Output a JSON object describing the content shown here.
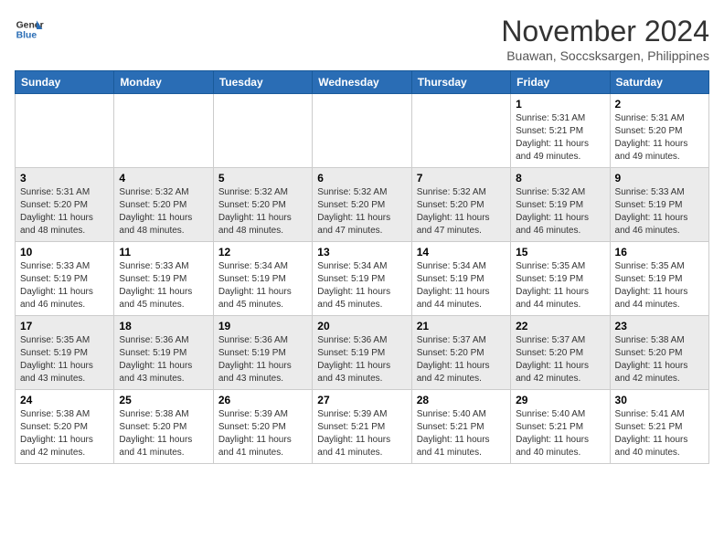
{
  "logo": {
    "line1": "General",
    "line2": "Blue"
  },
  "title": "November 2024",
  "subtitle": "Buawan, Soccsksargen, Philippines",
  "weekdays": [
    "Sunday",
    "Monday",
    "Tuesday",
    "Wednesday",
    "Thursday",
    "Friday",
    "Saturday"
  ],
  "weeks": [
    [
      {
        "day": "",
        "info": ""
      },
      {
        "day": "",
        "info": ""
      },
      {
        "day": "",
        "info": ""
      },
      {
        "day": "",
        "info": ""
      },
      {
        "day": "",
        "info": ""
      },
      {
        "day": "1",
        "info": "Sunrise: 5:31 AM\nSunset: 5:21 PM\nDaylight: 11 hours and 49 minutes."
      },
      {
        "day": "2",
        "info": "Sunrise: 5:31 AM\nSunset: 5:20 PM\nDaylight: 11 hours and 49 minutes."
      }
    ],
    [
      {
        "day": "3",
        "info": "Sunrise: 5:31 AM\nSunset: 5:20 PM\nDaylight: 11 hours and 48 minutes."
      },
      {
        "day": "4",
        "info": "Sunrise: 5:32 AM\nSunset: 5:20 PM\nDaylight: 11 hours and 48 minutes."
      },
      {
        "day": "5",
        "info": "Sunrise: 5:32 AM\nSunset: 5:20 PM\nDaylight: 11 hours and 48 minutes."
      },
      {
        "day": "6",
        "info": "Sunrise: 5:32 AM\nSunset: 5:20 PM\nDaylight: 11 hours and 47 minutes."
      },
      {
        "day": "7",
        "info": "Sunrise: 5:32 AM\nSunset: 5:20 PM\nDaylight: 11 hours and 47 minutes."
      },
      {
        "day": "8",
        "info": "Sunrise: 5:32 AM\nSunset: 5:19 PM\nDaylight: 11 hours and 46 minutes."
      },
      {
        "day": "9",
        "info": "Sunrise: 5:33 AM\nSunset: 5:19 PM\nDaylight: 11 hours and 46 minutes."
      }
    ],
    [
      {
        "day": "10",
        "info": "Sunrise: 5:33 AM\nSunset: 5:19 PM\nDaylight: 11 hours and 46 minutes."
      },
      {
        "day": "11",
        "info": "Sunrise: 5:33 AM\nSunset: 5:19 PM\nDaylight: 11 hours and 45 minutes."
      },
      {
        "day": "12",
        "info": "Sunrise: 5:34 AM\nSunset: 5:19 PM\nDaylight: 11 hours and 45 minutes."
      },
      {
        "day": "13",
        "info": "Sunrise: 5:34 AM\nSunset: 5:19 PM\nDaylight: 11 hours and 45 minutes."
      },
      {
        "day": "14",
        "info": "Sunrise: 5:34 AM\nSunset: 5:19 PM\nDaylight: 11 hours and 44 minutes."
      },
      {
        "day": "15",
        "info": "Sunrise: 5:35 AM\nSunset: 5:19 PM\nDaylight: 11 hours and 44 minutes."
      },
      {
        "day": "16",
        "info": "Sunrise: 5:35 AM\nSunset: 5:19 PM\nDaylight: 11 hours and 44 minutes."
      }
    ],
    [
      {
        "day": "17",
        "info": "Sunrise: 5:35 AM\nSunset: 5:19 PM\nDaylight: 11 hours and 43 minutes."
      },
      {
        "day": "18",
        "info": "Sunrise: 5:36 AM\nSunset: 5:19 PM\nDaylight: 11 hours and 43 minutes."
      },
      {
        "day": "19",
        "info": "Sunrise: 5:36 AM\nSunset: 5:19 PM\nDaylight: 11 hours and 43 minutes."
      },
      {
        "day": "20",
        "info": "Sunrise: 5:36 AM\nSunset: 5:19 PM\nDaylight: 11 hours and 43 minutes."
      },
      {
        "day": "21",
        "info": "Sunrise: 5:37 AM\nSunset: 5:20 PM\nDaylight: 11 hours and 42 minutes."
      },
      {
        "day": "22",
        "info": "Sunrise: 5:37 AM\nSunset: 5:20 PM\nDaylight: 11 hours and 42 minutes."
      },
      {
        "day": "23",
        "info": "Sunrise: 5:38 AM\nSunset: 5:20 PM\nDaylight: 11 hours and 42 minutes."
      }
    ],
    [
      {
        "day": "24",
        "info": "Sunrise: 5:38 AM\nSunset: 5:20 PM\nDaylight: 11 hours and 42 minutes."
      },
      {
        "day": "25",
        "info": "Sunrise: 5:38 AM\nSunset: 5:20 PM\nDaylight: 11 hours and 41 minutes."
      },
      {
        "day": "26",
        "info": "Sunrise: 5:39 AM\nSunset: 5:20 PM\nDaylight: 11 hours and 41 minutes."
      },
      {
        "day": "27",
        "info": "Sunrise: 5:39 AM\nSunset: 5:21 PM\nDaylight: 11 hours and 41 minutes."
      },
      {
        "day": "28",
        "info": "Sunrise: 5:40 AM\nSunset: 5:21 PM\nDaylight: 11 hours and 41 minutes."
      },
      {
        "day": "29",
        "info": "Sunrise: 5:40 AM\nSunset: 5:21 PM\nDaylight: 11 hours and 40 minutes."
      },
      {
        "day": "30",
        "info": "Sunrise: 5:41 AM\nSunset: 5:21 PM\nDaylight: 11 hours and 40 minutes."
      }
    ]
  ]
}
